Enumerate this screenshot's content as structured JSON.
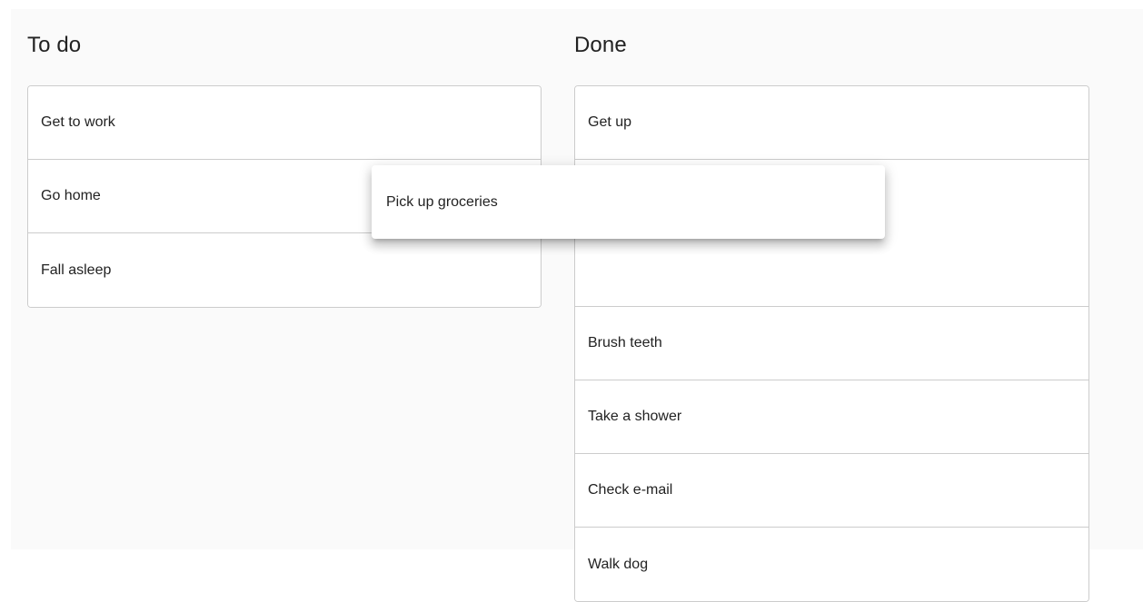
{
  "todo": {
    "title": "To do",
    "items": [
      {
        "label": "Get to work"
      },
      {
        "label": "Go home"
      },
      {
        "label": "Fall asleep"
      }
    ]
  },
  "done": {
    "title": "Done",
    "items": [
      {
        "label": "Get up"
      },
      {
        "label": "Brush teeth"
      },
      {
        "label": "Take a shower"
      },
      {
        "label": "Check e-mail"
      },
      {
        "label": "Walk dog"
      }
    ]
  },
  "drag_preview": {
    "label": "Pick up groceries"
  }
}
